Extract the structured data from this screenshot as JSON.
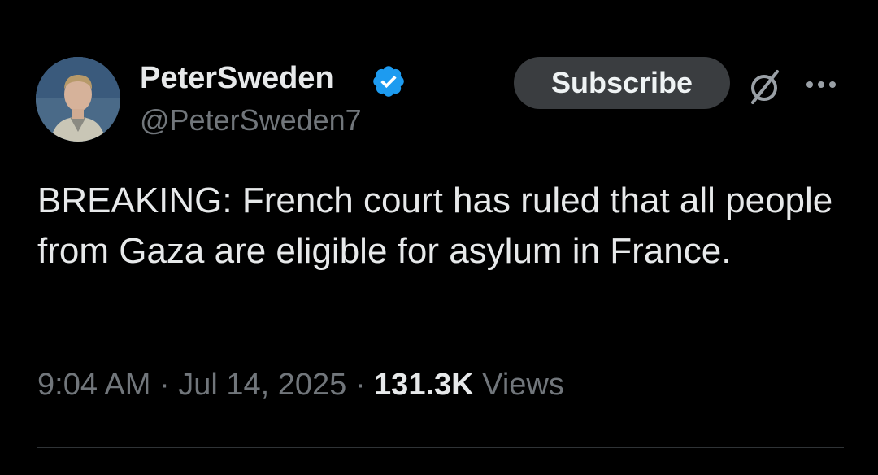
{
  "author": {
    "display_name": "PeterSweden",
    "handle": "@PeterSweden7",
    "verified": true,
    "avatar_icon": "user-avatar-photo"
  },
  "actions": {
    "subscribe_label": "Subscribe",
    "grok_icon": "grok-slash-icon",
    "more_icon": "more-options-icon"
  },
  "tweet": {
    "text": "BREAKING: French court has ruled that all people from Gaza are eligible for asylum in France."
  },
  "meta": {
    "time": "9:04 AM",
    "separator": "·",
    "date": "Jul 14, 2025",
    "views_count": "131.3K",
    "views_label": "Views"
  },
  "colors": {
    "background": "#000000",
    "primary_text": "#e7e9ea",
    "secondary_text": "#71767b",
    "verified_blue": "#1d9bf0",
    "subscribe_bg": "#3a3d40",
    "divider": "#2f3336"
  }
}
